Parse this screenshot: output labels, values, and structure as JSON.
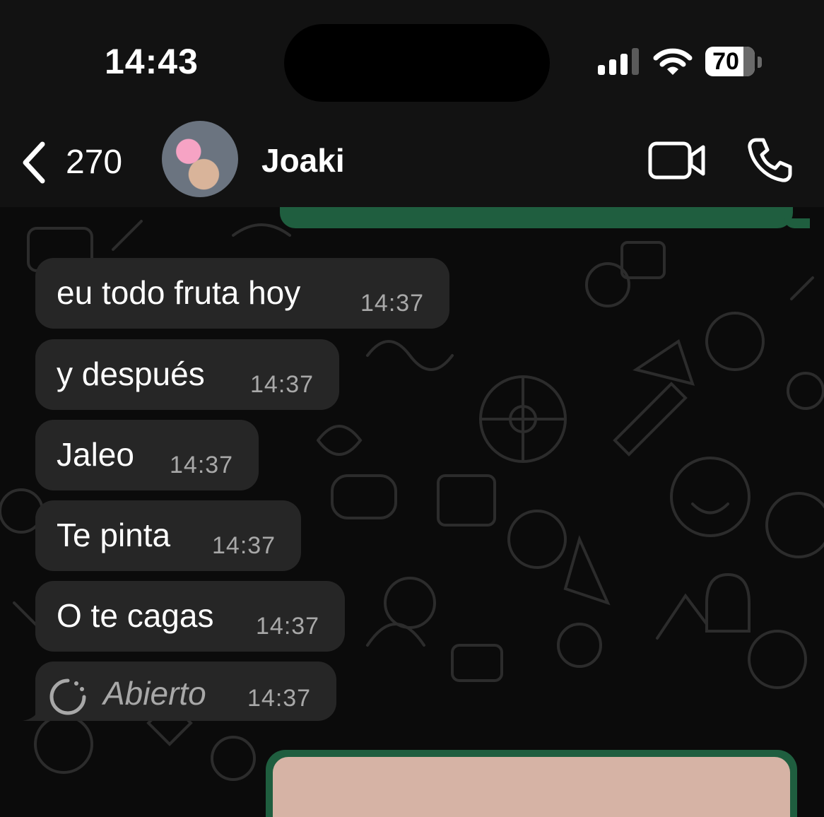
{
  "status_bar": {
    "time": "14:43",
    "battery_level": "70",
    "signal_bars": 3,
    "wifi": "connected"
  },
  "header": {
    "back_count": "270",
    "contact_name": "Joaki",
    "icons": [
      "chevron-left-icon",
      "video-call-icon",
      "phone-call-icon"
    ]
  },
  "messages": [
    {
      "text": "eu todo fruta hoy",
      "time": "14:37"
    },
    {
      "text": "y después",
      "time": "14:37"
    },
    {
      "text": "Jaleo",
      "time": "14:37"
    },
    {
      "text": "Te pinta",
      "time": "14:37"
    },
    {
      "text": "O te cagas",
      "time": "14:37"
    },
    {
      "text": "Abierto",
      "time": "14:37",
      "type": "view-once-opened"
    }
  ],
  "colors": {
    "background": "#0b0b0b",
    "bar": "#121212",
    "incoming_bubble": "#262626",
    "outgoing_bubble": "#1f5e3f",
    "time_text": "#a8a8a8"
  }
}
